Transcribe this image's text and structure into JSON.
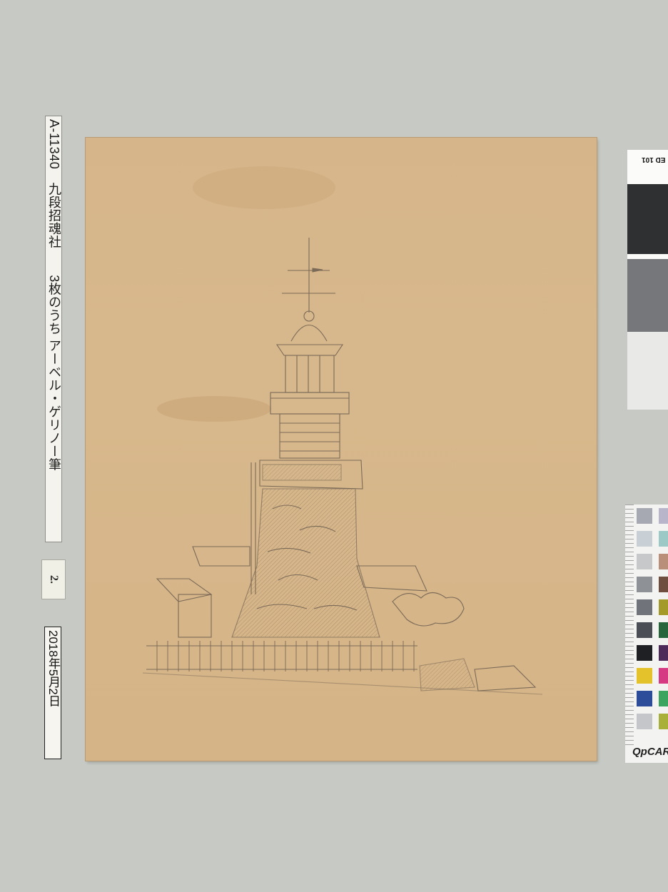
{
  "catalog_label": {
    "text": "A-11340　九段招魂社　　3枚のうち アーベル・ゲリノー筆"
  },
  "sheet_number": "2.",
  "date_label": "2018年5月2日",
  "gray_card": {
    "header": "ED 101",
    "blocks": [
      "#2f3032",
      "#75777b",
      "#e9e9e8"
    ]
  },
  "color_card": {
    "brand": "QpCAR",
    "swatches": [
      [
        "#a6a9b1",
        "#b8b4c9"
      ],
      [
        "#c9d0d5",
        "#9cc9c6"
      ],
      [
        "#c7c8ca",
        "#b98f7a"
      ],
      [
        "#8e9297",
        "#6f4d3f"
      ],
      [
        "#707379",
        "#a39a2a"
      ],
      [
        "#4b4e54",
        "#27653c"
      ],
      [
        "#1f2024",
        "#4d2a5a"
      ],
      [
        "#e3c22c",
        "#d63a82"
      ],
      [
        "#2d4d9a",
        "#3ba45e"
      ],
      [
        "#c4c6c9",
        "#a8b03a"
      ]
    ]
  },
  "drawing": {
    "subject": "lighthouse"
  }
}
